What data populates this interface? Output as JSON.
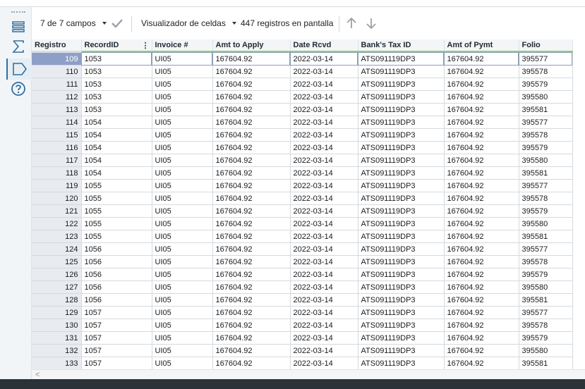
{
  "toolbar": {
    "fields_label": "7 de 7 campos",
    "viewer_label": "Visualizador de celdas",
    "records_label": "447 registros en pantalla"
  },
  "icons": {
    "fields_menu": "list-icon",
    "sum": "sigma-icon",
    "tag": "tag-icon",
    "help": "help-icon",
    "apply": "checkmark-icon",
    "up": "arrow-up-icon",
    "down": "arrow-down-icon",
    "scroll_left": "chevron-left-icon"
  },
  "colors": {
    "accent": "#2f6f9f",
    "selected_row": "#8e9fc7",
    "field_header_underline": "#8fd16a"
  },
  "table": {
    "columns": [
      "Registro",
      "RecordID",
      "Invoice #",
      "Amt to Apply",
      "Date Rcvd",
      "Bank's Tax ID",
      "Amt of Pymt",
      "Folio"
    ],
    "rows": [
      [
        "109",
        "1053",
        "UI05",
        "167604.92",
        "2022-03-14",
        "ATS091119DP3",
        "167604.92",
        "395577"
      ],
      [
        "110",
        "1053",
        "UI05",
        "167604.92",
        "2022-03-14",
        "ATS091119DP3",
        "167604.92",
        "395578"
      ],
      [
        "111",
        "1053",
        "UI05",
        "167604.92",
        "2022-03-14",
        "ATS091119DP3",
        "167604.92",
        "395579"
      ],
      [
        "112",
        "1053",
        "UI05",
        "167604.92",
        "2022-03-14",
        "ATS091119DP3",
        "167604.92",
        "395580"
      ],
      [
        "113",
        "1053",
        "UI05",
        "167604.92",
        "2022-03-14",
        "ATS091119DP3",
        "167604.92",
        "395581"
      ],
      [
        "114",
        "1054",
        "UI05",
        "167604.92",
        "2022-03-14",
        "ATS091119DP3",
        "167604.92",
        "395577"
      ],
      [
        "115",
        "1054",
        "UI05",
        "167604.92",
        "2022-03-14",
        "ATS091119DP3",
        "167604.92",
        "395578"
      ],
      [
        "116",
        "1054",
        "UI05",
        "167604.92",
        "2022-03-14",
        "ATS091119DP3",
        "167604.92",
        "395579"
      ],
      [
        "117",
        "1054",
        "UI05",
        "167604.92",
        "2022-03-14",
        "ATS091119DP3",
        "167604.92",
        "395580"
      ],
      [
        "118",
        "1054",
        "UI05",
        "167604.92",
        "2022-03-14",
        "ATS091119DP3",
        "167604.92",
        "395581"
      ],
      [
        "119",
        "1055",
        "UI05",
        "167604.92",
        "2022-03-14",
        "ATS091119DP3",
        "167604.92",
        "395577"
      ],
      [
        "120",
        "1055",
        "UI05",
        "167604.92",
        "2022-03-14",
        "ATS091119DP3",
        "167604.92",
        "395578"
      ],
      [
        "121",
        "1055",
        "UI05",
        "167604.92",
        "2022-03-14",
        "ATS091119DP3",
        "167604.92",
        "395579"
      ],
      [
        "122",
        "1055",
        "UI05",
        "167604.92",
        "2022-03-14",
        "ATS091119DP3",
        "167604.92",
        "395580"
      ],
      [
        "123",
        "1055",
        "UI05",
        "167604.92",
        "2022-03-14",
        "ATS091119DP3",
        "167604.92",
        "395581"
      ],
      [
        "124",
        "1056",
        "UI05",
        "167604.92",
        "2022-03-14",
        "ATS091119DP3",
        "167604.92",
        "395577"
      ],
      [
        "125",
        "1056",
        "UI05",
        "167604.92",
        "2022-03-14",
        "ATS091119DP3",
        "167604.92",
        "395578"
      ],
      [
        "126",
        "1056",
        "UI05",
        "167604.92",
        "2022-03-14",
        "ATS091119DP3",
        "167604.92",
        "395579"
      ],
      [
        "127",
        "1056",
        "UI05",
        "167604.92",
        "2022-03-14",
        "ATS091119DP3",
        "167604.92",
        "395580"
      ],
      [
        "128",
        "1056",
        "UI05",
        "167604.92",
        "2022-03-14",
        "ATS091119DP3",
        "167604.92",
        "395581"
      ],
      [
        "129",
        "1057",
        "UI05",
        "167604.92",
        "2022-03-14",
        "ATS091119DP3",
        "167604.92",
        "395577"
      ],
      [
        "130",
        "1057",
        "UI05",
        "167604.92",
        "2022-03-14",
        "ATS091119DP3",
        "167604.92",
        "395578"
      ],
      [
        "131",
        "1057",
        "UI05",
        "167604.92",
        "2022-03-14",
        "ATS091119DP3",
        "167604.92",
        "395579"
      ],
      [
        "132",
        "1057",
        "UI05",
        "167604.92",
        "2022-03-14",
        "ATS091119DP3",
        "167604.92",
        "395580"
      ],
      [
        "133",
        "1057",
        "UI05",
        "167604.92",
        "2022-03-14",
        "ATS091119DP3",
        "167604.92",
        "395581"
      ]
    ]
  }
}
